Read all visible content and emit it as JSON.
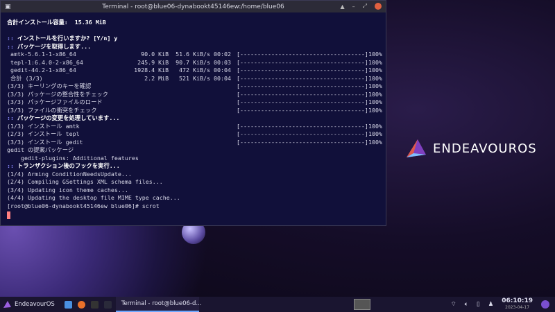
{
  "window": {
    "title": "Terminal - root@blue06-dynabookt45146ew:/home/blue06",
    "buttons": [
      "▲",
      "–",
      "⤢"
    ]
  },
  "terminal": {
    "lines": [
      {
        "text": "合計インストール容量:  15.36 MiB",
        "style": "b"
      },
      {
        "text": ""
      },
      {
        "prefix": "::",
        "text": " インストールを行いますか? [Y/n] y",
        "style": "b"
      },
      {
        "prefix": "::",
        "text": " パッケージを取得します...",
        "style": "b"
      },
      {
        "text": " amtk-5.6.1-1-x86_64",
        "stats": "90.0 KiB  51.6 KiB/s 00:02",
        "bar": "[------------------------------------]",
        "pct": "100%"
      },
      {
        "text": " tepl-1:6.4.0-2-x86_64",
        "stats": "245.9 KiB  90.7 KiB/s 00:03",
        "bar": "[------------------------------------]",
        "pct": "100%"
      },
      {
        "text": " gedit-44.2-1-x86_64",
        "stats": "1928.4 KiB   472 KiB/s 00:04",
        "bar": "[------------------------------------]",
        "pct": "100%"
      },
      {
        "text": " 合計 (3/3)",
        "stats": "2.2 MiB   521 KiB/s 00:04",
        "bar": "[------------------------------------]",
        "pct": "100%"
      },
      {
        "text": "(3/3) キーリングのキーを確認",
        "bar": "[------------------------------------]",
        "pct": "100%"
      },
      {
        "text": "(3/3) パッケージの整合性をチェック",
        "bar": "[------------------------------------]",
        "pct": "100%"
      },
      {
        "text": "(3/3) パッケージファイルのロード",
        "bar": "[------------------------------------]",
        "pct": "100%"
      },
      {
        "text": "(3/3) ファイルの衝突をチェック",
        "bar": "[------------------------------------]",
        "pct": "100%"
      },
      {
        "prefix": "::",
        "text": " パッケージの変更を処理しています...",
        "style": "b"
      },
      {
        "text": "(1/3) インストール amtk",
        "bar": "[------------------------------------]",
        "pct": "100%"
      },
      {
        "text": "(2/3) インストール tepl",
        "bar": "[------------------------------------]",
        "pct": "100%"
      },
      {
        "text": "(3/3) インストール gedit",
        "bar": "[------------------------------------]",
        "pct": "100%"
      },
      {
        "text": "gedit の提案パッケージ"
      },
      {
        "text": "    gedit-plugins: Additional features"
      },
      {
        "prefix": "::",
        "text": " トランザクション後のフックを実行...",
        "style": "b"
      },
      {
        "text": "(1/4) Arming ConditionNeedsUpdate..."
      },
      {
        "text": "(2/4) Compiling GSettings XML schema files..."
      },
      {
        "text": "(3/4) Updating icon theme caches..."
      },
      {
        "text": "(4/4) Updating the desktop file MIME type cache..."
      },
      {
        "text": "[root@blue06-dynabookt45146ew blue06]# scrot"
      }
    ]
  },
  "desktop": {
    "logo": "ENDEAVOUROS"
  },
  "taskbar": {
    "start": "EndeavourOS",
    "task": "Terminal - root@blue06-d...",
    "time": "06:10:19",
    "date": "2023-04-17"
  }
}
